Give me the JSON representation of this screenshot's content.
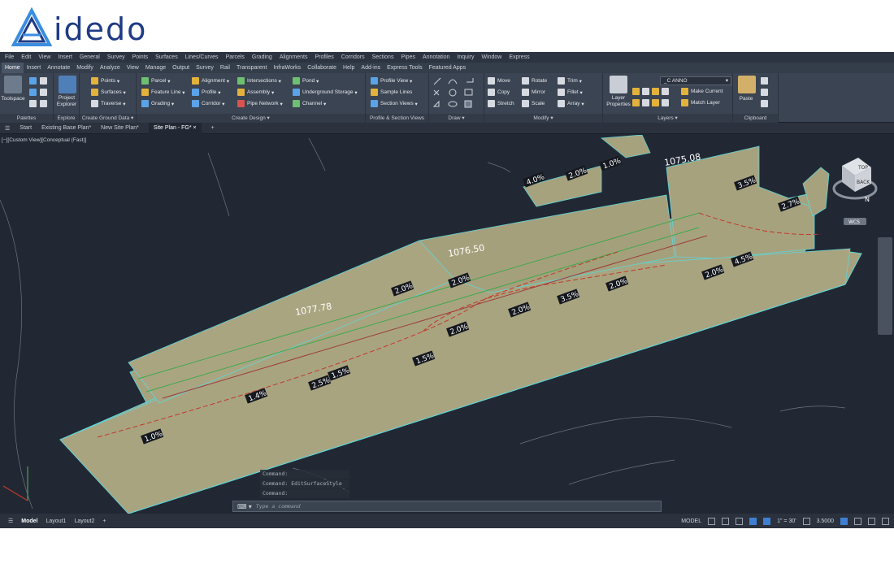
{
  "brand": {
    "name": "idedo"
  },
  "menu": [
    "File",
    "Edit",
    "View",
    "Insert",
    "General",
    "Survey",
    "Points",
    "Surfaces",
    "Lines/Curves",
    "Parcels",
    "Grading",
    "Alignments",
    "Profiles",
    "Corridors",
    "Sections",
    "Pipes",
    "Annotation",
    "Inquiry",
    "Window",
    "Express"
  ],
  "ribbon_tabs": [
    "Home",
    "Insert",
    "Annotate",
    "Modify",
    "Analyze",
    "View",
    "Manage",
    "Output",
    "Survey",
    "Rail",
    "Transparent",
    "InfraWorks",
    "Collaborate",
    "Help",
    "Add-ins",
    "Express Tools",
    "Featured Apps"
  ],
  "active_ribbon_tab": "Home",
  "ribbon": {
    "palettes": {
      "toolspace": "Toolspace",
      "title": "Palettes"
    },
    "explore": {
      "project_explorer": "Project Explorer",
      "title": "Explore"
    },
    "ground": {
      "points": "Points",
      "surfaces": "Surfaces",
      "traverse": "Traverse",
      "title": "Create Ground Data"
    },
    "design": {
      "parcel": "Parcel",
      "feature_line": "Feature Line",
      "grading": "Grading",
      "alignment": "Alignment",
      "profile": "Profile",
      "corridor": "Corridor",
      "intersections": "Intersections",
      "assembly": "Assembly",
      "pipe_network": "Pipe Network",
      "pond": "Pond",
      "underground_storage": "Underground Storage",
      "channel": "Channel",
      "title": "Create Design"
    },
    "profile_views": {
      "profile_view": "Profile View",
      "sample_lines": "Sample Lines",
      "section_views": "Section Views",
      "title": "Profile & Section Views"
    },
    "draw": {
      "title": "Draw"
    },
    "modify": {
      "move": "Move",
      "rotate": "Rotate",
      "trim": "Trim",
      "copy": "Copy",
      "mirror": "Mirror",
      "fillet": "Fillet",
      "stretch": "Stretch",
      "scale": "Scale",
      "array": "Array",
      "title": "Modify"
    },
    "layers": {
      "layer_properties": "Layer Properties",
      "current_layer": "_C ANNO",
      "make_current": "Make Current",
      "match_layer": "Match Layer",
      "title": "Layers"
    },
    "clipboard": {
      "paste": "Paste",
      "title": "Clipboard"
    }
  },
  "doc_tabs": [
    "Start",
    "Existing Base Plan*",
    "New Site Plan*",
    "Site Plan - FG*"
  ],
  "active_doc_tab": "Site Plan - FG*",
  "viewport": {
    "label": "[−][Custom View][Conceptual (Fast)]",
    "elevations": [
      "1077.78",
      "1076.50",
      "1075.08"
    ],
    "slopes": [
      "1.0%",
      "1.4%",
      "2.5%",
      "1.5%",
      "1.5%",
      "2.0%",
      "2.0%",
      "3.5%",
      "2.0%",
      "2.0%",
      "2.0%",
      "2.7%",
      "2.0%",
      "4.5%",
      "3.5%",
      "4.0%",
      "2.0%",
      "1.0%"
    ],
    "viewcube": {
      "face": "BACK",
      "top": "TOP",
      "compass_n": "N",
      "compass_w": "W",
      "wcs": "WCS"
    }
  },
  "command": {
    "history": [
      "Command:",
      "Command: EditSurfaceStyle",
      "Command:"
    ],
    "placeholder": "Type a command"
  },
  "status": {
    "layout_tabs": [
      "Model",
      "Layout1",
      "Layout2"
    ],
    "active_layout": "Model",
    "model_label": "MODEL",
    "scale": "1\" = 30'",
    "value": "3.5000"
  },
  "colors": {
    "surface_fill": "#a7a27e",
    "background": "#222833",
    "brand": "#1f3b86"
  }
}
